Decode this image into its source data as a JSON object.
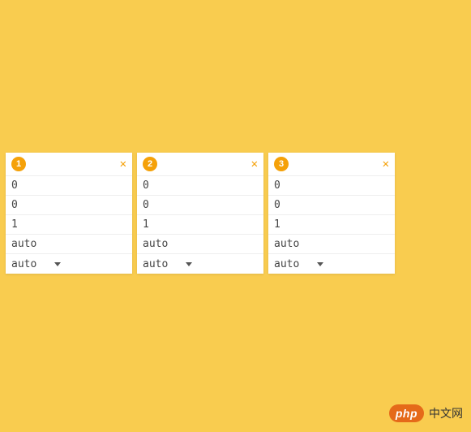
{
  "cards": [
    {
      "label": "1",
      "rows": [
        "0",
        "0",
        "1",
        "auto"
      ],
      "select": "auto"
    },
    {
      "label": "2",
      "rows": [
        "0",
        "0",
        "1",
        "auto"
      ],
      "select": "auto"
    },
    {
      "label": "3",
      "rows": [
        "0",
        "0",
        "1",
        "auto"
      ],
      "select": "auto"
    }
  ],
  "watermark": {
    "pill": "php",
    "text": "中文网"
  }
}
